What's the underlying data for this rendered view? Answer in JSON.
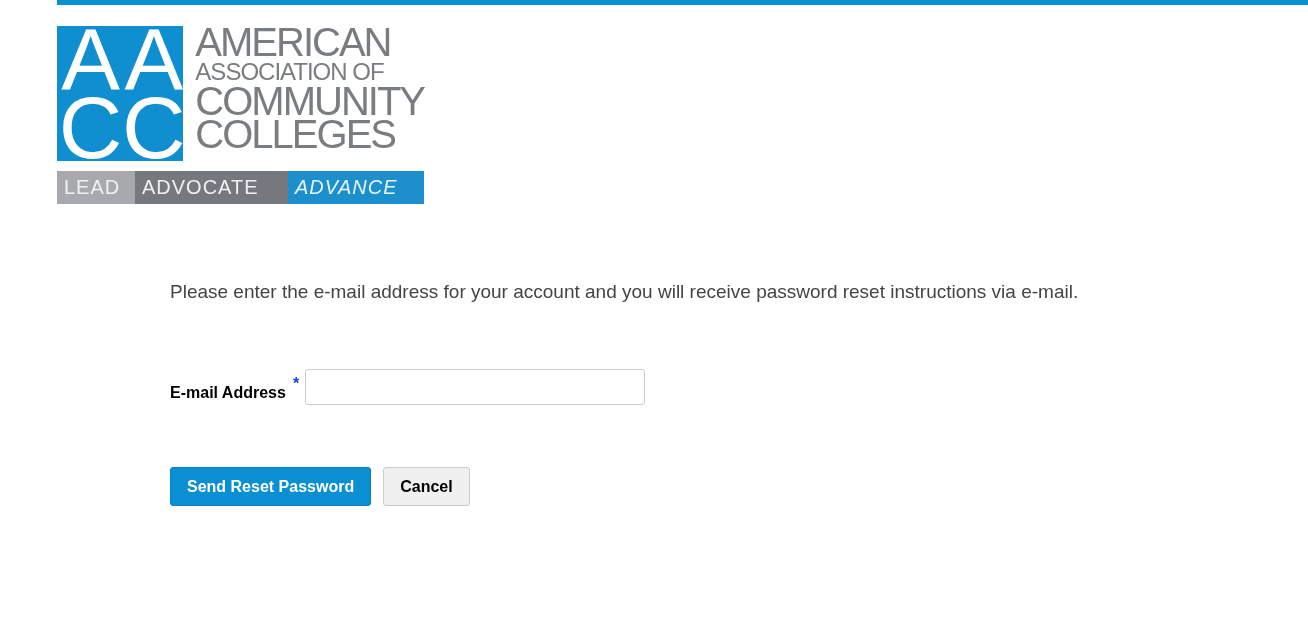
{
  "logo": {
    "monogram": [
      "A",
      "A",
      "C",
      "C"
    ],
    "name_lines": [
      "AMERICAN",
      "ASSOCIATION OF",
      "COMMUNITY",
      "COLLEGES"
    ],
    "tagline": [
      {
        "text": "LEAD",
        "kind": "light"
      },
      {
        "text": "ADVOCATE",
        "kind": "dark"
      },
      {
        "text": "ADVANCE",
        "kind": "accent"
      }
    ]
  },
  "instructions": "Please enter the e-mail address for your account and you will receive password reset instructions via e-mail.",
  "email_field": {
    "label": "E-mail Address",
    "required_mark": "*"
  },
  "buttons": [
    {
      "label": "Send Reset Password",
      "kind": "primary"
    },
    {
      "label": "Cancel",
      "kind": "secondary"
    }
  ]
}
